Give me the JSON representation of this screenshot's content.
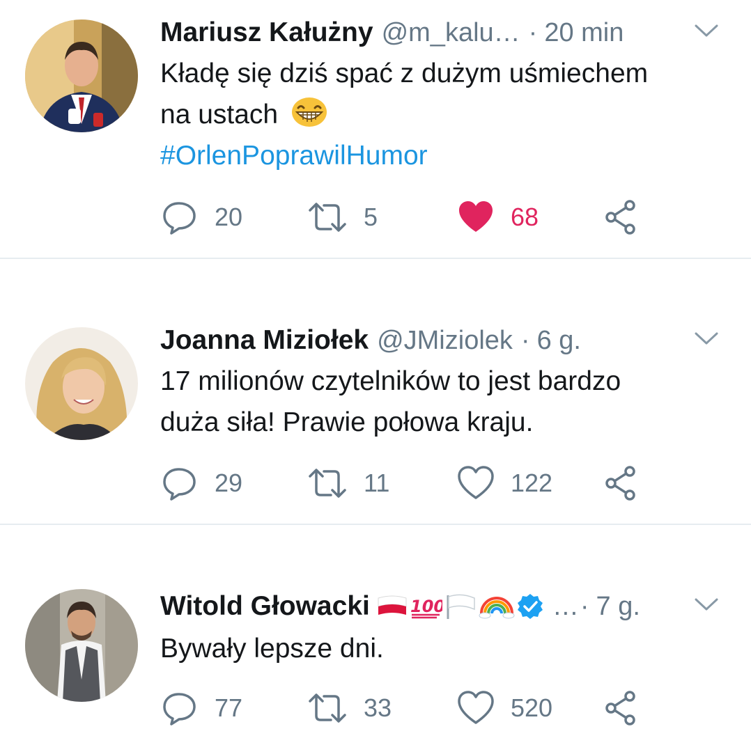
{
  "tweets": [
    {
      "name": "Mariusz Kałużny",
      "handle": "@m_kalu…",
      "separator": "·",
      "time": "20 min",
      "text_line1": "Kładę się dziś spać z dużym uśmiechem",
      "text_line2": "na ustach",
      "emoji": "grinning-face-emoji",
      "hashtag": "#OrlenPoprawilHumor",
      "replies": "20",
      "retweets": "5",
      "likes": "68",
      "liked": true
    },
    {
      "name": "Joanna Miziołek",
      "handle": "@JMiziolek",
      "separator": "·",
      "time": "6 g.",
      "text_line1": "17 milionów czytelników to jest bardzo",
      "text_line2": "duża siła! Prawie połowa kraju.",
      "replies": "29",
      "retweets": "11",
      "likes": "122",
      "liked": false
    },
    {
      "name": "Witold Głowacki",
      "name_badges": [
        "poland-flag-emoji",
        "hundred-points-emoji",
        "white-flag-emoji",
        "rainbow-emoji",
        "verified-badge-icon"
      ],
      "handle_truncated": "…",
      "separator": "·",
      "time": "7 g.",
      "text_line1": "Bywały lepsze dni.",
      "replies": "77",
      "retweets": "33",
      "likes": "520",
      "liked": false
    }
  ],
  "colors": {
    "text": "#14171a",
    "secondary": "#657786",
    "link": "#1b95e0",
    "like": "#e0245e",
    "divider": "#e6ecf0",
    "verified": "#1da1f2"
  },
  "icons": {
    "reply": "reply-icon",
    "retweet": "retweet-icon",
    "like": "heart-icon",
    "share": "share-icon",
    "menu": "chevron-down-icon"
  }
}
